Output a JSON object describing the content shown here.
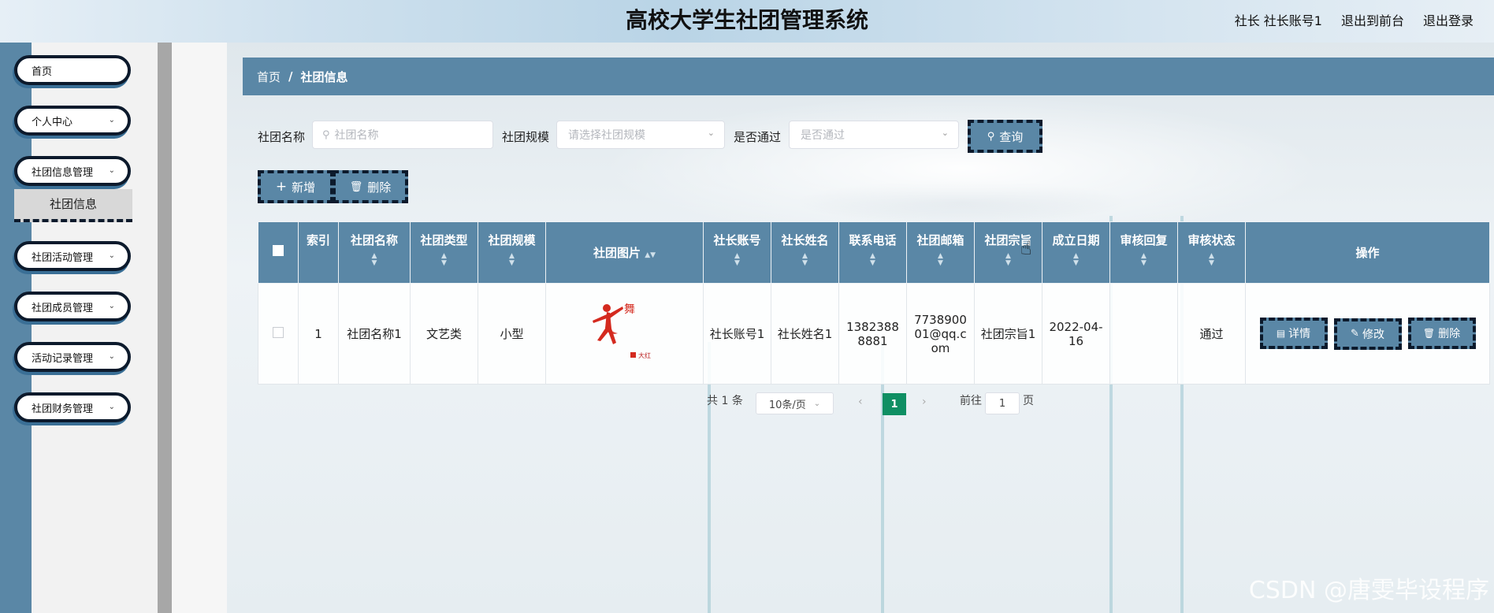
{
  "header": {
    "title": "高校大学生社团管理系统",
    "user_label": "社长  社长账号1",
    "to_front": "退出到前台",
    "logout": "退出登录"
  },
  "sidebar": {
    "items": [
      {
        "label": "首页",
        "has_chevron": false
      },
      {
        "label": "个人中心",
        "has_chevron": true
      },
      {
        "label": "社团信息管理",
        "has_chevron": true
      },
      {
        "label": "社团活动管理",
        "has_chevron": true
      },
      {
        "label": "社团成员管理",
        "has_chevron": true
      },
      {
        "label": "活动记录管理",
        "has_chevron": true
      },
      {
        "label": "社团财务管理",
        "has_chevron": true
      }
    ],
    "active_subitem": "社团信息"
  },
  "breadcrumb": {
    "home": "首页",
    "separator": "/",
    "current": "社团信息"
  },
  "filters": {
    "name_label": "社团名称",
    "name_placeholder": "社团名称",
    "scale_label": "社团规模",
    "scale_placeholder": "请选择社团规模",
    "pass_label": "是否通过",
    "pass_placeholder": "是否通过",
    "search_button": "查询"
  },
  "actions": {
    "add": "新增",
    "delete": "删除"
  },
  "table": {
    "headers": {
      "index": "索引",
      "name": "社团名称",
      "type": "社团类型",
      "scale": "社团规模",
      "image": "社团图片",
      "leader_account": "社长账号",
      "leader_name": "社长姓名",
      "phone": "联系电话",
      "email": "社团邮箱",
      "purpose": "社团宗旨",
      "founded": "成立日期",
      "review_reply": "审核回复",
      "review_status": "审核状态",
      "operations": "操作"
    },
    "rows": [
      {
        "index": "1",
        "name": "社团名称1",
        "type": "文艺类",
        "scale": "小型",
        "image_caption": "大红",
        "leader_account": "社长账号1",
        "leader_name": "社长姓名1",
        "phone": "13823888881",
        "email": "773890001@qq.com",
        "purpose": "社团宗旨1",
        "founded": "2022-04-16",
        "review_reply": "",
        "review_status": "通过"
      }
    ],
    "row_buttons": {
      "detail": "详情",
      "edit": "修改",
      "delete": "删除"
    }
  },
  "pagination": {
    "total_prefix": "共",
    "total": "1",
    "total_suffix": "条",
    "page_size": "10条/页",
    "current_page": "1",
    "goto_prefix": "前往",
    "goto_value": "1",
    "goto_suffix": "页"
  },
  "watermark": "CSDN @唐雯毕设程序",
  "colors": {
    "accent": "#5a87a6",
    "dark_border": "#0c1a2c",
    "page_active": "#0f8f63"
  }
}
